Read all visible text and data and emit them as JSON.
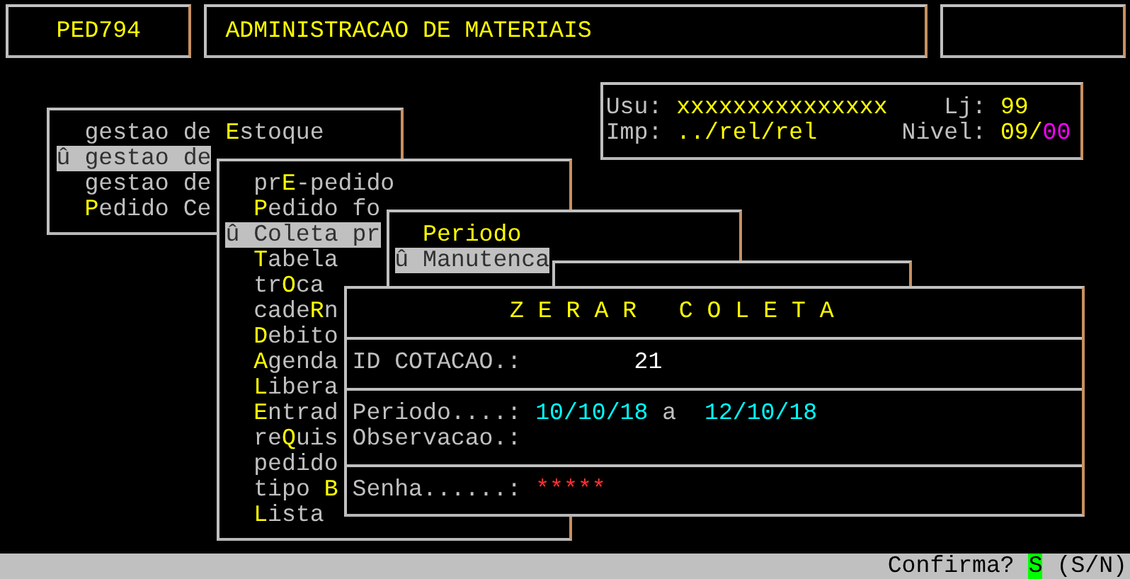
{
  "header": {
    "program": "PED794",
    "title": "ADMINISTRACAO DE MATERIAIS"
  },
  "session": {
    "user_label": "Usu:",
    "user": "xxxxxxxxxxxxxxx",
    "store_label": "Lj:",
    "store": "99",
    "printer_label": "Imp:",
    "printer": "../rel/rel",
    "level_label": "Nivel:",
    "level_main": "09/",
    "level_sub": "00"
  },
  "menus": [
    {
      "items": [
        {
          "selected": false,
          "pre": "gestao de ",
          "key": "E",
          "post": "stoque"
        },
        {
          "selected": true,
          "pre": "û gestao de"
        },
        {
          "selected": false,
          "pre": "gestao de"
        },
        {
          "selected": false,
          "key": "P",
          "post": "edido Ce"
        }
      ]
    },
    {
      "items": [
        {
          "selected": false,
          "pre": "pr",
          "key": "E",
          "post": "-pedido"
        },
        {
          "selected": false,
          "key": "P",
          "post": "edido fo"
        },
        {
          "selected": true,
          "pre": "û Coleta pr"
        },
        {
          "selected": false,
          "key": "T",
          "post": "abela"
        },
        {
          "selected": false,
          "pre": "tr",
          "key": "O",
          "post": "ca"
        },
        {
          "selected": false,
          "pre": "cade",
          "key": "R",
          "post": "n"
        },
        {
          "selected": false,
          "key": "D",
          "post": "ebito"
        },
        {
          "selected": false,
          "key": "A",
          "post": "genda"
        },
        {
          "selected": false,
          "key": "L",
          "post": "ibera"
        },
        {
          "selected": false,
          "key": "E",
          "post": "ntrad"
        },
        {
          "selected": false,
          "pre": "re",
          "key": "Q",
          "post": "uis"
        },
        {
          "selected": false,
          "pre": "pedido"
        },
        {
          "selected": false,
          "pre": "tipo ",
          "key": "B"
        },
        {
          "selected": false,
          "key": "L",
          "post": "ista"
        }
      ]
    },
    {
      "items": [
        {
          "selected": false,
          "key": "Periodo"
        },
        {
          "selected": true,
          "pre": "û Manutenca"
        }
      ]
    }
  ],
  "dialog": {
    "title": "Z E R A R   C O L E T A",
    "fields": [
      {
        "kind": "number",
        "label": "ID COTACAO.:",
        "value": "21"
      },
      {
        "kind": "range",
        "label": "Periodo....:",
        "from": "10/10/18",
        "separator": "a",
        "to": "12/10/18"
      },
      {
        "kind": "empty",
        "label": "Observacao.:"
      },
      {
        "kind": "password",
        "label": "Senha......:",
        "value": "*****"
      }
    ]
  },
  "status_bar": {
    "prompt": "Confirma?",
    "answer": "S",
    "options": "(S/N)"
  }
}
